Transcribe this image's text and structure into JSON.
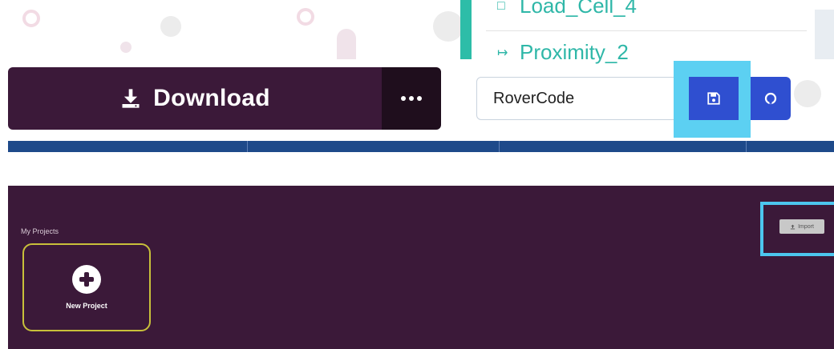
{
  "editor": {
    "tree_items": [
      {
        "label": "Load_Cell_4",
        "icon": "square-icon"
      },
      {
        "label": "Proximity_2",
        "icon": "arrow-right-icon"
      }
    ],
    "download": {
      "label": "Download",
      "icon": "download-icon"
    },
    "more": {
      "icon": "more-dots-icon"
    },
    "project_name": {
      "value": "RoverCode"
    },
    "save": {
      "icon": "save-floppy-icon"
    },
    "github": {
      "icon": "github-icon"
    },
    "colors": {
      "primary": "#3b1939",
      "primary_dark": "#1f0e1d",
      "accent_blue": "#2f4fd0",
      "highlight": "#5cd0f2",
      "teal": "#2fb7a8"
    }
  },
  "projects": {
    "section_title": "My Projects",
    "new_project": {
      "label": "New Project",
      "icon": "plus-circle-icon"
    },
    "import": {
      "label": "Import",
      "icon": "upload-icon"
    },
    "colors": {
      "panel_bg": "#3b1939",
      "card_border": "#c8c03a",
      "highlight": "#4cc6ee"
    }
  }
}
